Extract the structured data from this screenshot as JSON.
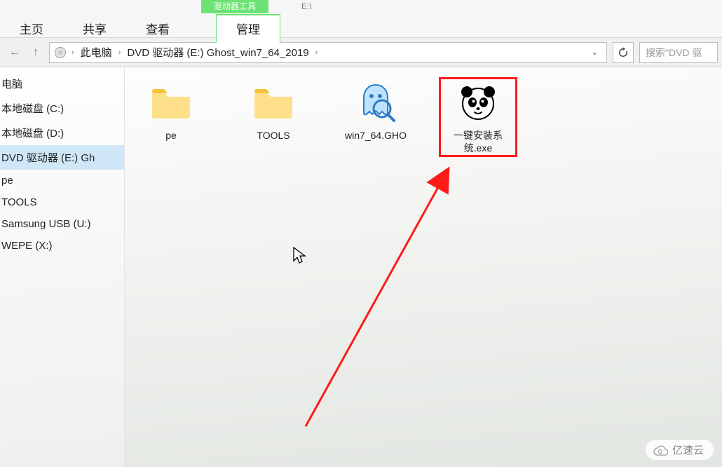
{
  "ribbon": {
    "context_tab": "驱动器工具",
    "drive_letter": "E:\\",
    "tabs": {
      "home": "主页",
      "share": "共享",
      "view": "查看",
      "manage": "管理"
    }
  },
  "address": {
    "crumb_pc": "此电脑",
    "crumb_drive": "DVD 驱动器 (E:) Ghost_win7_64_2019",
    "search_placeholder": "搜索\"DVD 驱"
  },
  "sidebar": {
    "items": [
      {
        "label": "电脑"
      },
      {
        "label": "本地磁盘 (C:)"
      },
      {
        "label": "本地磁盘 (D:)"
      },
      {
        "label": "DVD 驱动器 (E:) Gh"
      },
      {
        "label": "pe"
      },
      {
        "label": "TOOLS"
      },
      {
        "label": "Samsung USB (U:)"
      },
      {
        "label": "WEPE (X:)"
      }
    ]
  },
  "files": {
    "pe": "pe",
    "tools": "TOOLS",
    "gho": "win7_64.GHO",
    "exe": "一键安装系统.exe"
  },
  "watermark": "亿速云"
}
